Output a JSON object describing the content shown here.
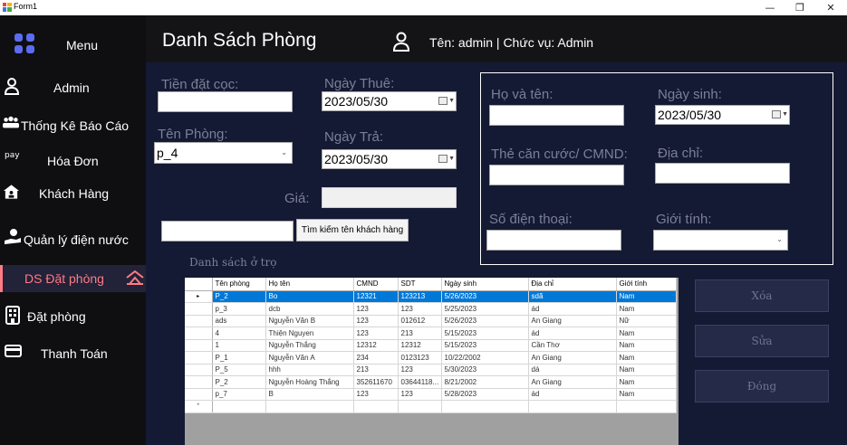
{
  "window": {
    "title": "Form1",
    "minimize": "—",
    "maximize": "❐",
    "close": "✕"
  },
  "sidebar": {
    "menu_label": "Menu",
    "items": [
      {
        "label": "Admin",
        "icon": "person-icon"
      },
      {
        "label": "Thống Kê Báo Cáo",
        "icon": "team-icon"
      },
      {
        "label": "Hóa Đơn",
        "icon": "pay-icon"
      },
      {
        "label": "Khách Hàng",
        "icon": "house-user-icon"
      },
      {
        "label": "Quản lý điện nước",
        "icon": "hand-user-icon"
      },
      {
        "label": "DS Đặt phòng",
        "icon": "tent-icon",
        "active": true
      },
      {
        "label": "Đặt phòng",
        "icon": "building-icon"
      },
      {
        "label": "Thanh Toán",
        "icon": "card-icon"
      }
    ],
    "pay_icon_text": "pay"
  },
  "header": {
    "title": "Danh Sách Phòng",
    "user_info": "Tên: admin | Chức vụ: Admin"
  },
  "booking_form": {
    "deposit_label": "Tiền đặt cọc:",
    "deposit_value": "",
    "rent_date_label": "Ngày Thuê:",
    "rent_date_value": "2023/05/30",
    "room_label": "Tên Phòng:",
    "room_value": "p_4",
    "return_date_label": "Ngày Trả:",
    "return_date_value": "2023/05/30",
    "price_label": "Giá:",
    "price_value": "",
    "search_value": "",
    "search_button": "Tìm kiếm tên khách hàng"
  },
  "guest_form": {
    "name_label": "Họ và tên:",
    "dob_label": "Ngày sinh:",
    "dob_value": "2023/05/30",
    "id_label": "Thẻ căn cước/ CMND:",
    "address_label": "Địa chỉ:",
    "phone_label": "Số điện thoại:",
    "gender_label": "Giới tính:",
    "gender_value": ""
  },
  "list": {
    "label": "Danh sách ở trọ",
    "columns": [
      "Tên phòng",
      "Họ tên",
      "CMND",
      "SDT",
      "Ngày sinh",
      "Địa chỉ",
      "Giới tính"
    ],
    "rows": [
      [
        "P_2",
        "Bo",
        "12321",
        "123213",
        "5/26/2023",
        "sdã",
        "Nam"
      ],
      [
        "p_3",
        "dcb",
        "123",
        "123",
        "5/25/2023",
        "ád",
        "Nam"
      ],
      [
        "ads",
        "Nguyễn Văn B",
        "123",
        "012612",
        "5/26/2023",
        "An Giang",
        "Nữ"
      ],
      [
        "4",
        "Thiện Nguyen",
        "123",
        "213",
        "5/15/2023",
        "ád",
        "Nam"
      ],
      [
        "1",
        "Nguyễn Thắng",
        "12312",
        "12312",
        "5/15/2023",
        "Cần Thơ",
        "Nam"
      ],
      [
        "P_1",
        "Nguyễn Văn A",
        "234",
        "0123123",
        "10/22/2002",
        "An Giang",
        "Nam"
      ],
      [
        "P_5",
        "hhh",
        "213",
        "123",
        "5/30/2023",
        "dá",
        "Nam"
      ],
      [
        "P_2",
        "Nguyễn Hoàng Thắng",
        "352611670",
        "03644118...",
        "8/21/2002",
        "An Giang",
        "Nam"
      ],
      [
        "p_7",
        "B",
        "123",
        "123",
        "5/28/2023",
        "ád",
        "Nam"
      ]
    ],
    "selected_row": 0,
    "current_row_marker": "▸",
    "new_row_marker": "*"
  },
  "actions": {
    "delete": "Xóa",
    "edit": "Sửa",
    "close": "Đóng"
  },
  "colors": {
    "sidebar": "#0f0f12",
    "main": "#141a33",
    "accent": "#ff7b84",
    "selection": "#0078d7"
  }
}
